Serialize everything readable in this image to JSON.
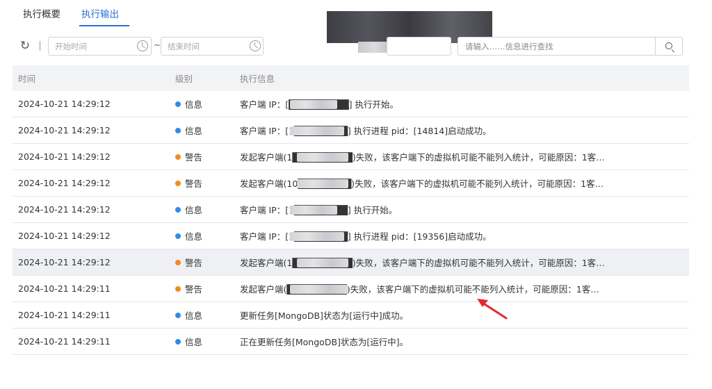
{
  "tabs": [
    {
      "label": "执行概要",
      "active": false
    },
    {
      "label": "执行输出",
      "active": true
    }
  ],
  "filters": {
    "start_placeholder": "开始时间",
    "range_separator": "~",
    "end_placeholder": "结束时间",
    "search_placeholder": "请输入……信息进行查找"
  },
  "icons": {
    "refresh": "refresh-icon",
    "clock": "clock-icon",
    "search": "search-icon",
    "annotation": "red-arrow"
  },
  "colors": {
    "accent": "#2b6fd6",
    "info_dot": "#2f8ce6",
    "warn_dot": "#f08c1c",
    "arrow": "#e8262b"
  },
  "table": {
    "headers": {
      "time": "时间",
      "level": "级别",
      "message": "执行信息"
    },
    "rows": [
      {
        "time": "2024-10-21 14:29:12",
        "level": "信息",
        "level_type": "info",
        "message": "客户端 IP：[█████████] 执行开始。"
      },
      {
        "time": "2024-10-21 14:29:12",
        "level": "信息",
        "level_type": "info",
        "message": "客户端 IP：[1████████] 执行进程 pid：[14814]启动成功。"
      },
      {
        "time": "2024-10-21 14:29:12",
        "level": "警告",
        "level_type": "warn",
        "message": "发起客户端(1█████████)失败，该客户端下的虚拟机可能不能列入统计，可能原因：1客…"
      },
      {
        "time": "2024-10-21 14:29:12",
        "level": "警告",
        "level_type": "warn",
        "message": "发起客户端(10████████)失败，该客户端下的虚拟机可能不能列入统计，可能原因：1客…"
      },
      {
        "time": "2024-10-21 14:29:12",
        "level": "信息",
        "level_type": "info",
        "message": "客户端 IP：[1████████] 执行开始。"
      },
      {
        "time": "2024-10-21 14:29:12",
        "level": "信息",
        "level_type": "info",
        "message": "客户端 IP：[1████████] 执行进程 pid：[19356]启动成功。"
      },
      {
        "time": "2024-10-21 14:29:12",
        "level": "警告",
        "level_type": "warn",
        "message": "发起客户端(1█████████)失败，该客户端下的虚拟机可能不能列入统计，可能原因：1客…",
        "highlighted": true
      },
      {
        "time": "2024-10-21 14:29:11",
        "level": "警告",
        "level_type": "warn",
        "message": "发起客户端(█████████)失败，该客户端下的虚拟机可能不能列入统计，可能原因：1客…"
      },
      {
        "time": "2024-10-21 14:29:11",
        "level": "信息",
        "level_type": "info",
        "message": "更新任务[MongoDB]状态为[运行中]成功。"
      },
      {
        "time": "2024-10-21 14:29:11",
        "level": "信息",
        "level_type": "info",
        "message": "正在更新任务[MongoDB]状态为[运行中]。"
      }
    ]
  }
}
